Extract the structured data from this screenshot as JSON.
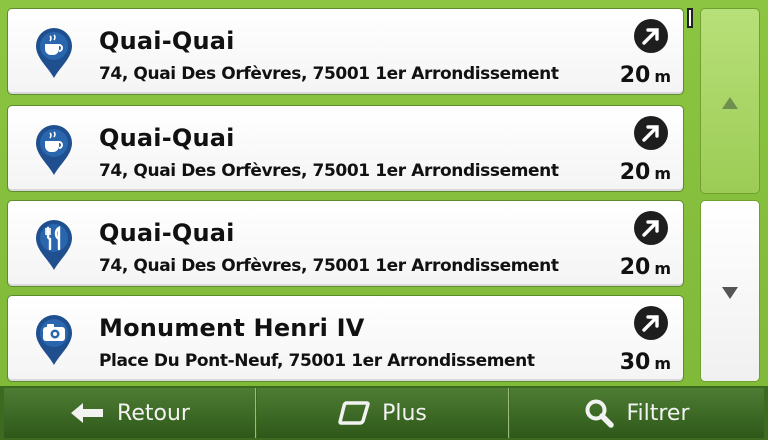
{
  "results": [
    {
      "name": "Quai-Quai",
      "address": "74, Quai Des Orfèvres, 75001 1er Arrondissement",
      "distance": "20",
      "unit": "m",
      "icon": "cafe-cup-icon"
    },
    {
      "name": "Quai-Quai",
      "address": "74, Quai Des Orfèvres, 75001 1er Arrondissement",
      "distance": "20",
      "unit": "m",
      "icon": "cafe-cup-icon"
    },
    {
      "name": "Quai-Quai",
      "address": "74, Quai Des Orfèvres, 75001 1er Arrondissement",
      "distance": "20",
      "unit": "m",
      "icon": "restaurant-cutlery-icon"
    },
    {
      "name": "Monument Henri IV",
      "address": "Place Du Pont-Neuf, 75001 1er Arrondissement",
      "distance": "30",
      "unit": "m",
      "icon": "camera-sight-icon"
    }
  ],
  "bottom_bar": {
    "back_label": "Retour",
    "more_label": "Plus",
    "filter_label": "Filtrer"
  },
  "colors": {
    "background": "#86c23e",
    "pin": "#1f4f8f",
    "bottom_bar": "#3c6b20",
    "scroll_up_active": "#a8d463"
  }
}
